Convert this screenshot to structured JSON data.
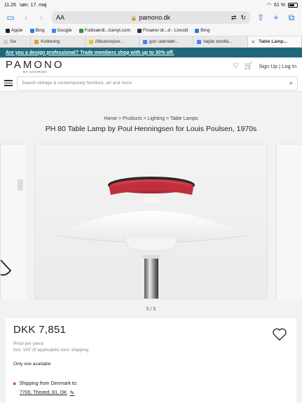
{
  "status": {
    "time": "11.26",
    "date": "søn. 17. maj",
    "battery": "61 %"
  },
  "safari": {
    "aa": "AA",
    "url": "pamono.dk",
    "dots": "•••"
  },
  "bookmarks": [
    {
      "label": "Apple",
      "color": "#222222"
    },
    {
      "label": "Bing",
      "color": "#2b7bd6"
    },
    {
      "label": "Google",
      "color": "#4285f4"
    },
    {
      "label": "Fuldværdi...lsenyt.com",
      "color": "#3a8a3a"
    },
    {
      "label": "Frisører dr...d - Livsstil",
      "color": "#333333"
    },
    {
      "label": "Bing",
      "color": "#2b7bd6"
    }
  ],
  "tabs": [
    {
      "label": "Sw"
    },
    {
      "label": "Kvittering"
    },
    {
      "label": "Afbudsrejser..."
    },
    {
      "label": "gori udendør..."
    },
    {
      "label": "højde bordla..."
    },
    {
      "label": "Table Lamp..."
    }
  ],
  "promo": {
    "text": "Are you a design professional? Trade members shop with up to 30% off."
  },
  "header": {
    "logo": "PAMONO",
    "logo_sub": "BY CHAIRISH",
    "signup": "Sign Up | Log In"
  },
  "search": {
    "placeholder": "Search vintage & contemporary furniture, art and more"
  },
  "breadcrumb": "Home > Products > Lighting > Table Lamps",
  "product": {
    "title": "PH 80 Table Lamp by Poul Henningsen for Louis Poulsen, 1970s",
    "image_counter": "5 / 5",
    "price": "DKK 7,851",
    "price_per": "Price per piece",
    "vat": "Incl. VAT (if applicable) excl. shipping",
    "availability": "Only one available",
    "shipping_label": "Shipping from Denmark to:",
    "shipping_location": "7700, Thisted, 81, DK"
  },
  "colors": {
    "promo_bg": "#1e6a7a",
    "pin": "#c23c8e",
    "lamp_red": "#c8323a"
  }
}
